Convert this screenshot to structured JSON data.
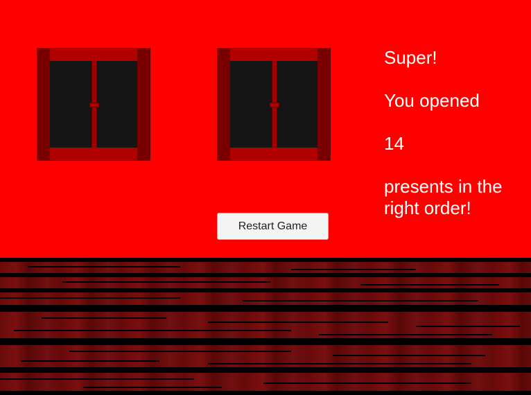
{
  "scene": {
    "wall_color": "#ff0000",
    "floor_color": "#6a0a0a",
    "windows": [
      {
        "name": "window-1",
        "pane_color": "#151515",
        "frame_color": "#800000"
      },
      {
        "name": "window-2",
        "pane_color": "#151515",
        "frame_color": "#800000"
      }
    ]
  },
  "message": {
    "line1": "Super!",
    "line2": "You opened",
    "count": "14",
    "line4": "presents in the right order!"
  },
  "controls": {
    "restart_label": "Restart Game"
  }
}
